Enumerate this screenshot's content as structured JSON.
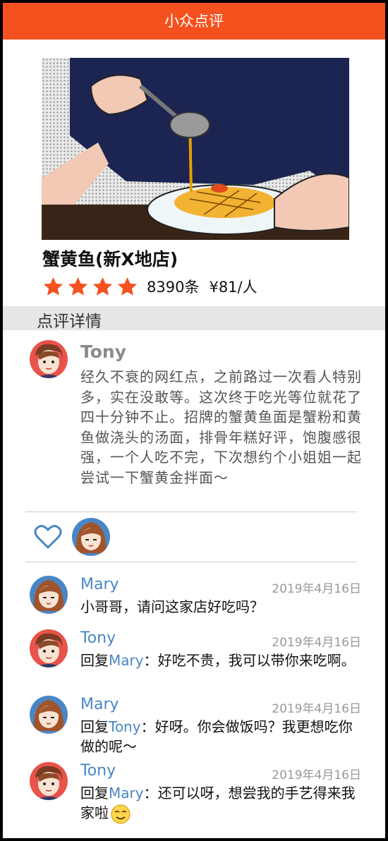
{
  "app": {
    "title": "小众点评"
  },
  "shop": {
    "name": "蟹黄鱼(新X地店)",
    "stars": 4,
    "review_count": "8390条",
    "price": "¥81/人"
  },
  "section": {
    "title": "点评详情"
  },
  "review": {
    "author": "Tony",
    "text": "经久不衰的网红点，之前路过一次看人特别多，实在没敢等。这次终于吃光等位就花了四十分钟不止。招牌的蟹黄鱼面是蟹粉和黄鱼做浇头的汤面，排骨年糕好评，饱腹感很强，一个人吃不完，下次想约个小姐姐一起尝试一下蟹黄金拌面～"
  },
  "likes": {
    "icon": "heart-icon"
  },
  "comments": [
    {
      "author": "Mary",
      "date": "2019年4月16日",
      "reply_prefix": "",
      "reply_to": "",
      "text": "小哥哥，请问这家店好吃吗？"
    },
    {
      "author": "Tony",
      "date": "2019年4月16日",
      "reply_prefix": "回复",
      "reply_to": "Mary",
      "text": "：好吃不贵，我可以带你来吃啊。"
    },
    {
      "author": "Mary",
      "date": "2019年4月16日",
      "reply_prefix": "回复",
      "reply_to": "Tony",
      "text": "：好呀。你会做饭吗？我更想吃你做的呢～"
    },
    {
      "author": "Tony",
      "date": "2019年4月16日",
      "reply_prefix": "回复",
      "reply_to": "Mary",
      "text": "：还可以呀，想尝我的手艺得来我家啦"
    }
  ],
  "colors": {
    "brand": "#f4511e",
    "name_link": "#4a86c5",
    "star": "#f4511e"
  }
}
